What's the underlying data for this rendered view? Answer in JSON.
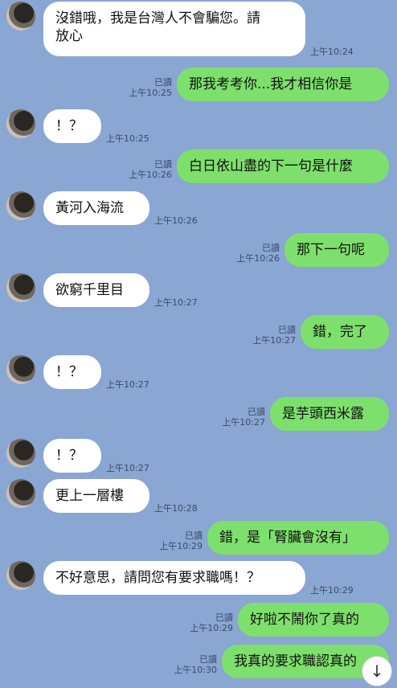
{
  "colors": {
    "background": "#8aa6d3",
    "incoming_bubble": "#ffffff",
    "outgoing_bubble": "#7ee06c"
  },
  "messages": [
    {
      "side": "them",
      "text": "沒錯哦，我是台灣人不會騙您。請\n放心",
      "time": "上午10:24",
      "read": ""
    },
    {
      "side": "me",
      "text": "那我考考你...我才相信你是",
      "time": "上午10:25",
      "read": "已讀"
    },
    {
      "side": "them",
      "text": "！？",
      "time": "上午10:25",
      "read": ""
    },
    {
      "side": "me",
      "text": "白日依山盡的下一句是什麼",
      "time": "上午10:26",
      "read": "已讀"
    },
    {
      "side": "them",
      "text": "黃河入海流",
      "time": "上午10:26",
      "read": ""
    },
    {
      "side": "me",
      "text": "那下一句呢",
      "time": "上午10:26",
      "read": "已讀"
    },
    {
      "side": "them",
      "text": "欲窮千里目",
      "time": "上午10:27",
      "read": ""
    },
    {
      "side": "me",
      "text": "錯，完了",
      "time": "上午10:27",
      "read": "已讀"
    },
    {
      "side": "them",
      "text": "！？",
      "time": "上午10:27",
      "read": ""
    },
    {
      "side": "me",
      "text": "是芋頭西米露",
      "time": "上午10:27",
      "read": "已讀"
    },
    {
      "side": "them",
      "text": "！？",
      "time": "上午10:27",
      "read": ""
    },
    {
      "side": "them",
      "text": "更上一層樓",
      "time": "上午10:28",
      "read": ""
    },
    {
      "side": "me",
      "text": "錯，是「腎臟會沒有」",
      "time": "上午10:29",
      "read": "已讀"
    },
    {
      "side": "them",
      "text": "不好意思，請問您有要求職嗎！？",
      "time": "上午10:29",
      "read": ""
    },
    {
      "side": "me",
      "text": "好啦不鬧你了真的",
      "time": "上午10:29",
      "read": "已讀"
    },
    {
      "side": "me",
      "text": "我真的要求職認真的",
      "time": "上午10:30",
      "read": "已讀"
    }
  ],
  "scroll_button": {
    "icon": "arrow-down-icon",
    "glyph": "↓"
  }
}
